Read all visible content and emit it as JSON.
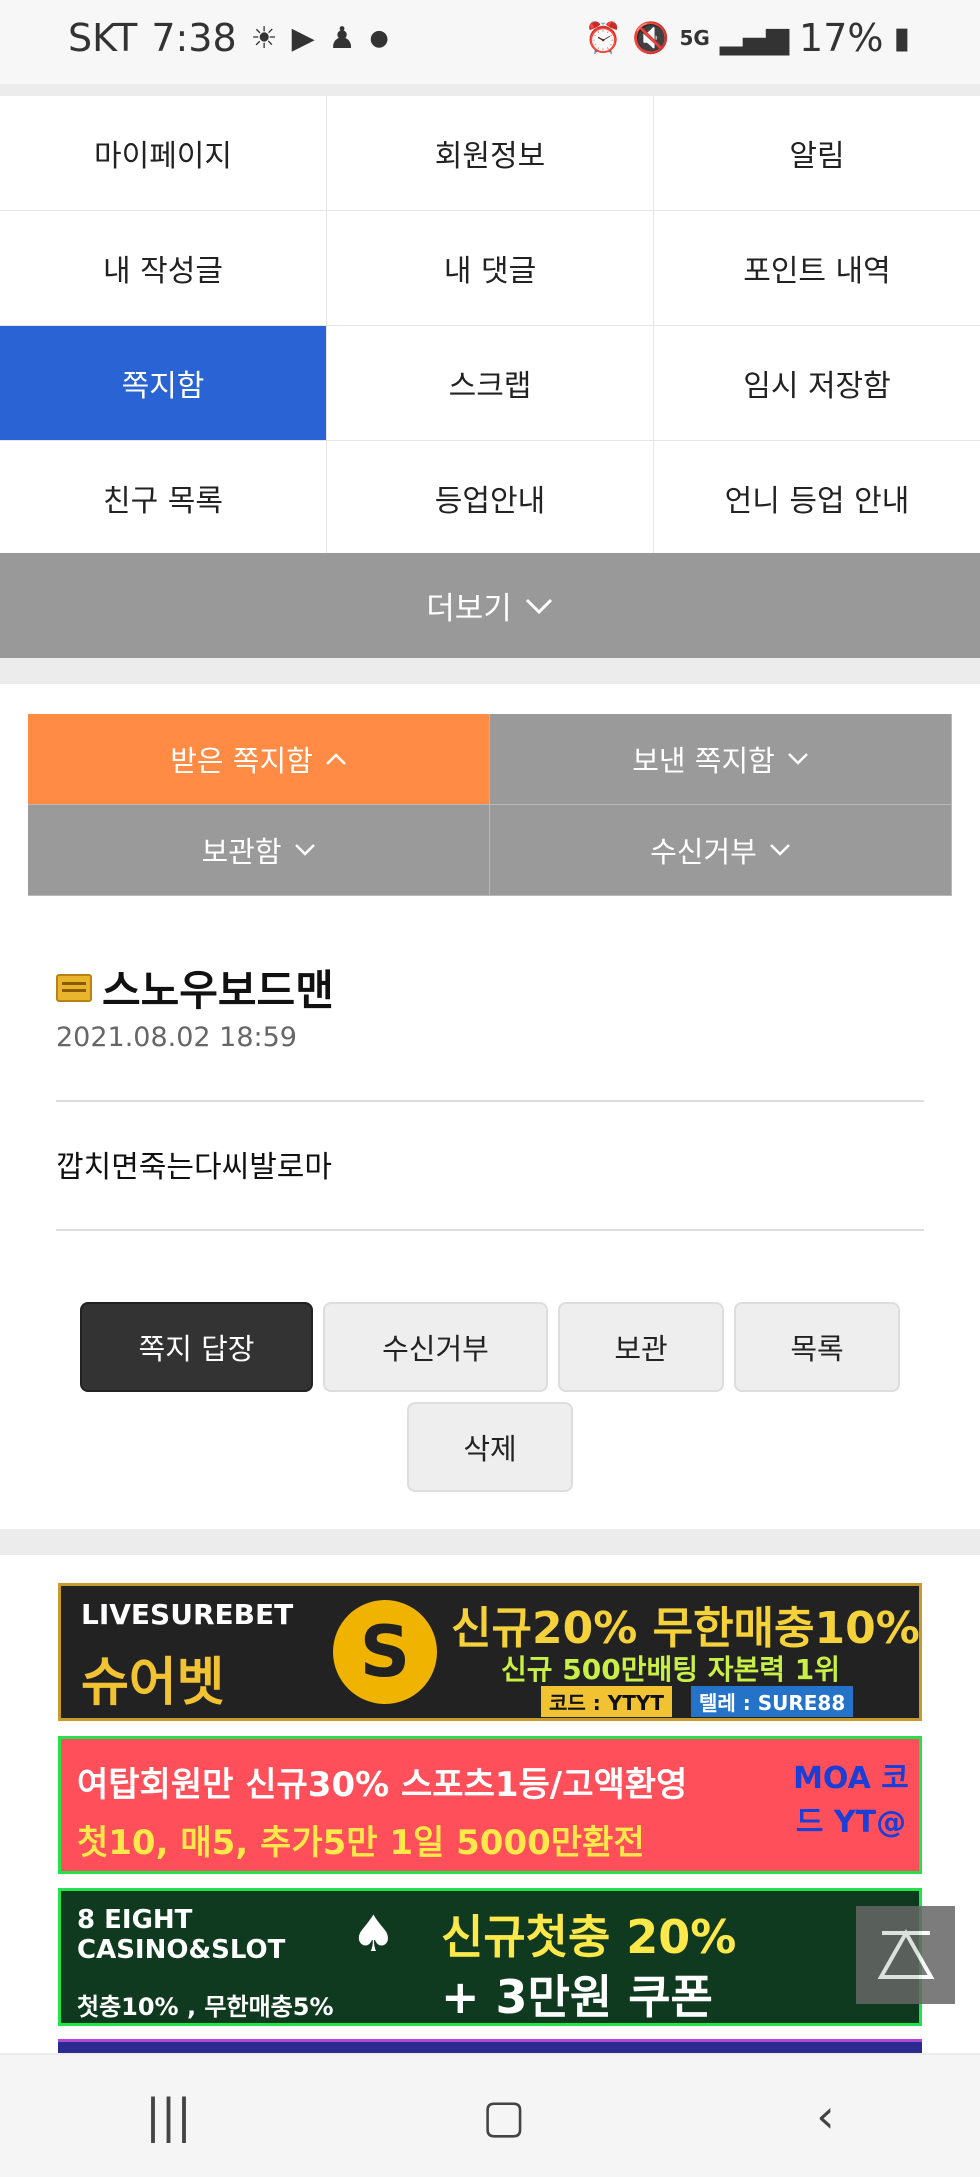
{
  "status_bar": {
    "carrier": "SKT",
    "time": "7:38",
    "network": "5G",
    "battery": "17%"
  },
  "menu_grid": [
    [
      "마이페이지",
      "회원정보",
      "알림"
    ],
    [
      "내 작성글",
      "내 댓글",
      "포인트 내역"
    ],
    [
      "쪽지함",
      "스크랩",
      "임시 저장함"
    ],
    [
      "친구 목록",
      "등업안내",
      "언니 등업 안내"
    ]
  ],
  "active_menu": "쪽지함",
  "more_label": "더보기",
  "tabs": [
    {
      "label": "받은 쪽지함",
      "chevron": "^"
    },
    {
      "label": "보낸 쪽지함",
      "chevron": "v"
    },
    {
      "label": "보관함",
      "chevron": "v"
    },
    {
      "label": "수신거부",
      "chevron": "v"
    }
  ],
  "message": {
    "from": "스노우보드맨",
    "date": "2021.08.02 18:59",
    "body": "깝치면죽는다씨발로마"
  },
  "actions": {
    "reply": "쪽지 답장",
    "block": "수신거부",
    "keep": "보관",
    "list": "목록",
    "delete": "삭제"
  },
  "banners": {
    "b1": {
      "brand": "LIVESUREBET",
      "name": "슈어벳",
      "headline": "신규20% 무한매충10%",
      "sub": "신규 500만배팅 자본력 1위",
      "code": "코드 : YTYT",
      "telegram": "텔레 : SURE88"
    },
    "b2": {
      "left": "여탑회원만 신규30% 스포츠1등/고액환영",
      "line2": "첫10, 매5, 추가5만 1일 5000만환전",
      "side": "MOA 코드 YT@"
    },
    "b3": {
      "brand": "8 EIGHT CASINO&SLOT",
      "line1": "신규첫충 20%",
      "line2": "+ 3만원 쿠폰",
      "small": "첫충10% , 무한매충5%"
    }
  },
  "colors": {
    "active_blue": "#2a64d4",
    "active_tab": "#ff8b44",
    "tab_gray": "#9a9a9a"
  }
}
